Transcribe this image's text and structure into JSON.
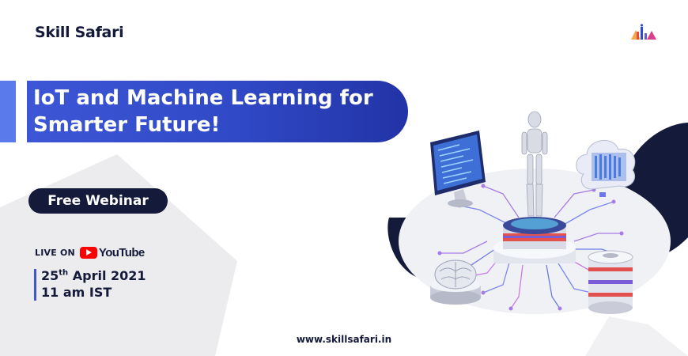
{
  "brand": {
    "logo_text": "Skill Safari",
    "mark_icon": "bar-chart-mark-icon"
  },
  "title": {
    "line1": "IoT and Machine Learning for",
    "line2": "Smarter Future!"
  },
  "badge": {
    "label": "Free Webinar"
  },
  "live": {
    "prefix": "LIVE ON",
    "platform": "YouTube",
    "platform_icon": "youtube-play-icon"
  },
  "schedule": {
    "day": "25",
    "day_suffix": "th",
    "month_year": "April 2021",
    "time": "11 am IST"
  },
  "footer": {
    "url": "www.skillsafari.in"
  },
  "illustration": {
    "icons": [
      "robot-icon",
      "monitor-code-icon",
      "cloud-data-icon",
      "brain-icon",
      "database-icon",
      "circuit-board-icon"
    ]
  },
  "colors": {
    "navy": "#141a3a",
    "blue": "#3049c6",
    "accent_blue": "#5a79ea",
    "grey_shape": "#ececef",
    "youtube_red": "#ff0000"
  }
}
